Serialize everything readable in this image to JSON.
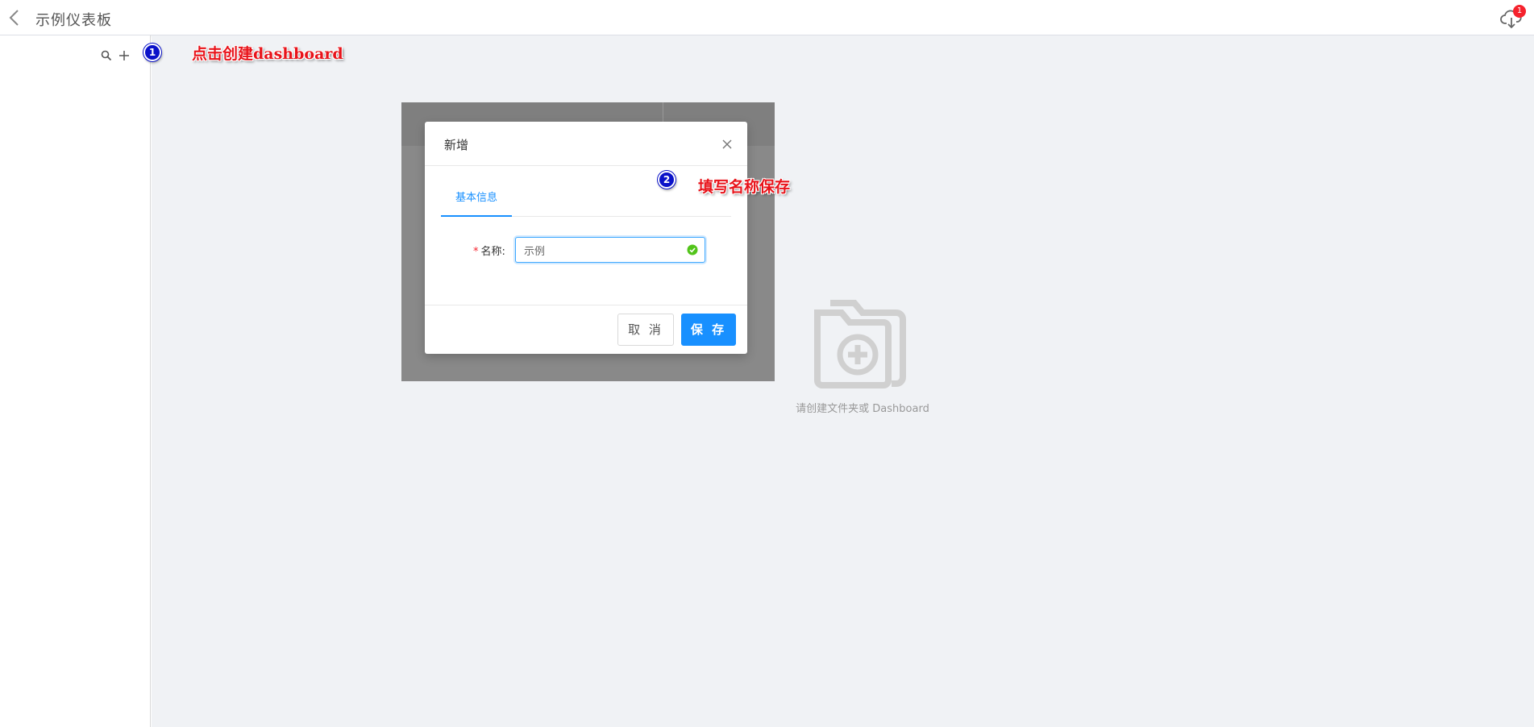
{
  "header": {
    "title": "示例仪表板",
    "notification_count": "1"
  },
  "annotations": {
    "step1_number": "1",
    "step1_text": "点击创建dashboard",
    "step2_number": "2",
    "step2_text": "填写名称保存"
  },
  "empty_state": {
    "text": "请创建文件夹或 Dashboard"
  },
  "modal": {
    "title": "新增",
    "tabs": [
      {
        "label": "基本信息",
        "active": true
      }
    ],
    "field_label": "名称:",
    "field_value": "示例",
    "cancel_label": "取 消",
    "save_label": "保 存"
  },
  "colors": {
    "primary": "#1890ff",
    "annotation_text": "#e8131a",
    "annotation_circle": "#0a12c9",
    "success": "#52c41a",
    "badge": "#f5222d"
  }
}
